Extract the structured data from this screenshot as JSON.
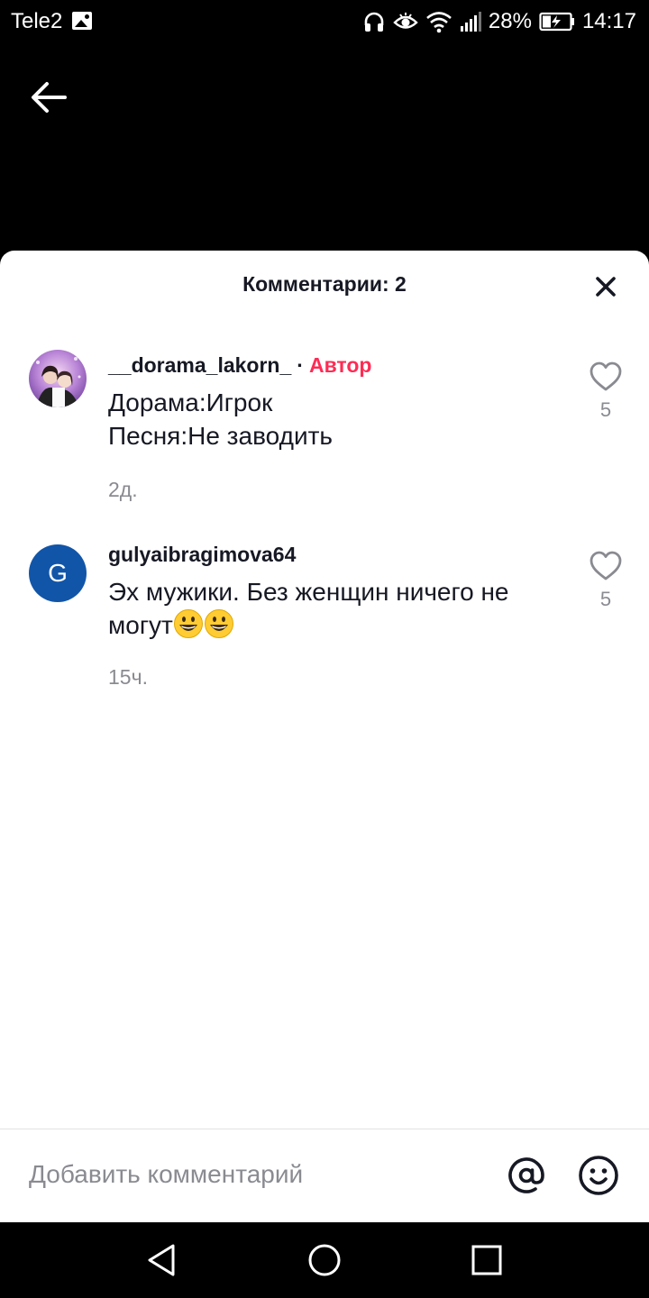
{
  "status_bar": {
    "carrier": "Tele2",
    "battery_percent": "28%",
    "time": "14:17",
    "icons": [
      "gallery-icon",
      "headphones-icon",
      "eye-icon",
      "wifi-icon",
      "signal-icon",
      "battery-charging-icon"
    ]
  },
  "header": {
    "title": "Комментарии: 2",
    "back_icon": "arrow-left-icon",
    "close_icon": "close-icon"
  },
  "comments": [
    {
      "username": "__dorama_lakorn_",
      "separator": "·",
      "badge": "Автор",
      "text": "Дорама:Игрок\nПесня:Не заводить",
      "time": "2д.",
      "likes": "5",
      "avatar": "photo"
    },
    {
      "username": "gulyaibragimova64",
      "text": "Эх мужики. Без женщин ничего не могут",
      "text_emoji": [
        "grinning-face",
        "grinning-face"
      ],
      "time": "15ч.",
      "likes": "5",
      "avatar_letter": "G"
    }
  ],
  "input": {
    "placeholder": "Добавить комментарий",
    "mention_icon": "at-sign-icon",
    "emoji_icon": "smiley-icon"
  },
  "nav": {
    "icons": [
      "back-triangle-icon",
      "home-circle-icon",
      "recents-square-icon"
    ]
  },
  "colors": {
    "accent": "#fe2c55",
    "avatar_bg": "#1155a8",
    "text_primary": "#161823",
    "text_secondary": "#8a8b91"
  }
}
